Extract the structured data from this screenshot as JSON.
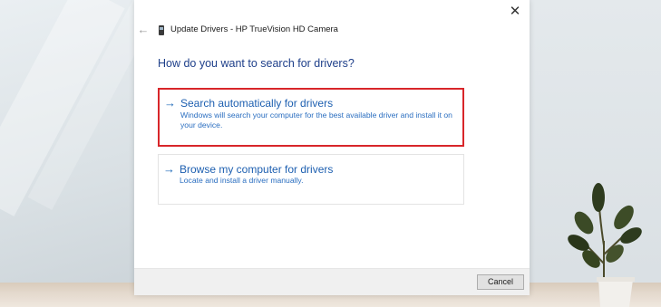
{
  "dialog": {
    "window_title": "Update Drivers - HP TrueVision HD Camera",
    "back_glyph": "←",
    "close_glyph": "✕",
    "heading": "How do you want to search for drivers?",
    "options": [
      {
        "arrow": "→",
        "title": "Search automatically for drivers",
        "description": "Windows will search your computer for the best available driver and install it on your device.",
        "selected": true
      },
      {
        "arrow": "→",
        "title": "Browse my computer for drivers",
        "description": "Locate and install a driver manually.",
        "selected": false
      }
    ],
    "cancel_label": "Cancel"
  },
  "colors": {
    "heading": "#1e3f8a",
    "link": "#1d5fb0",
    "highlight": "#d8262a"
  },
  "icons": {
    "title": "device-icon",
    "back": "back-arrow-icon",
    "close": "close-icon",
    "option": "arrow-right-icon"
  }
}
